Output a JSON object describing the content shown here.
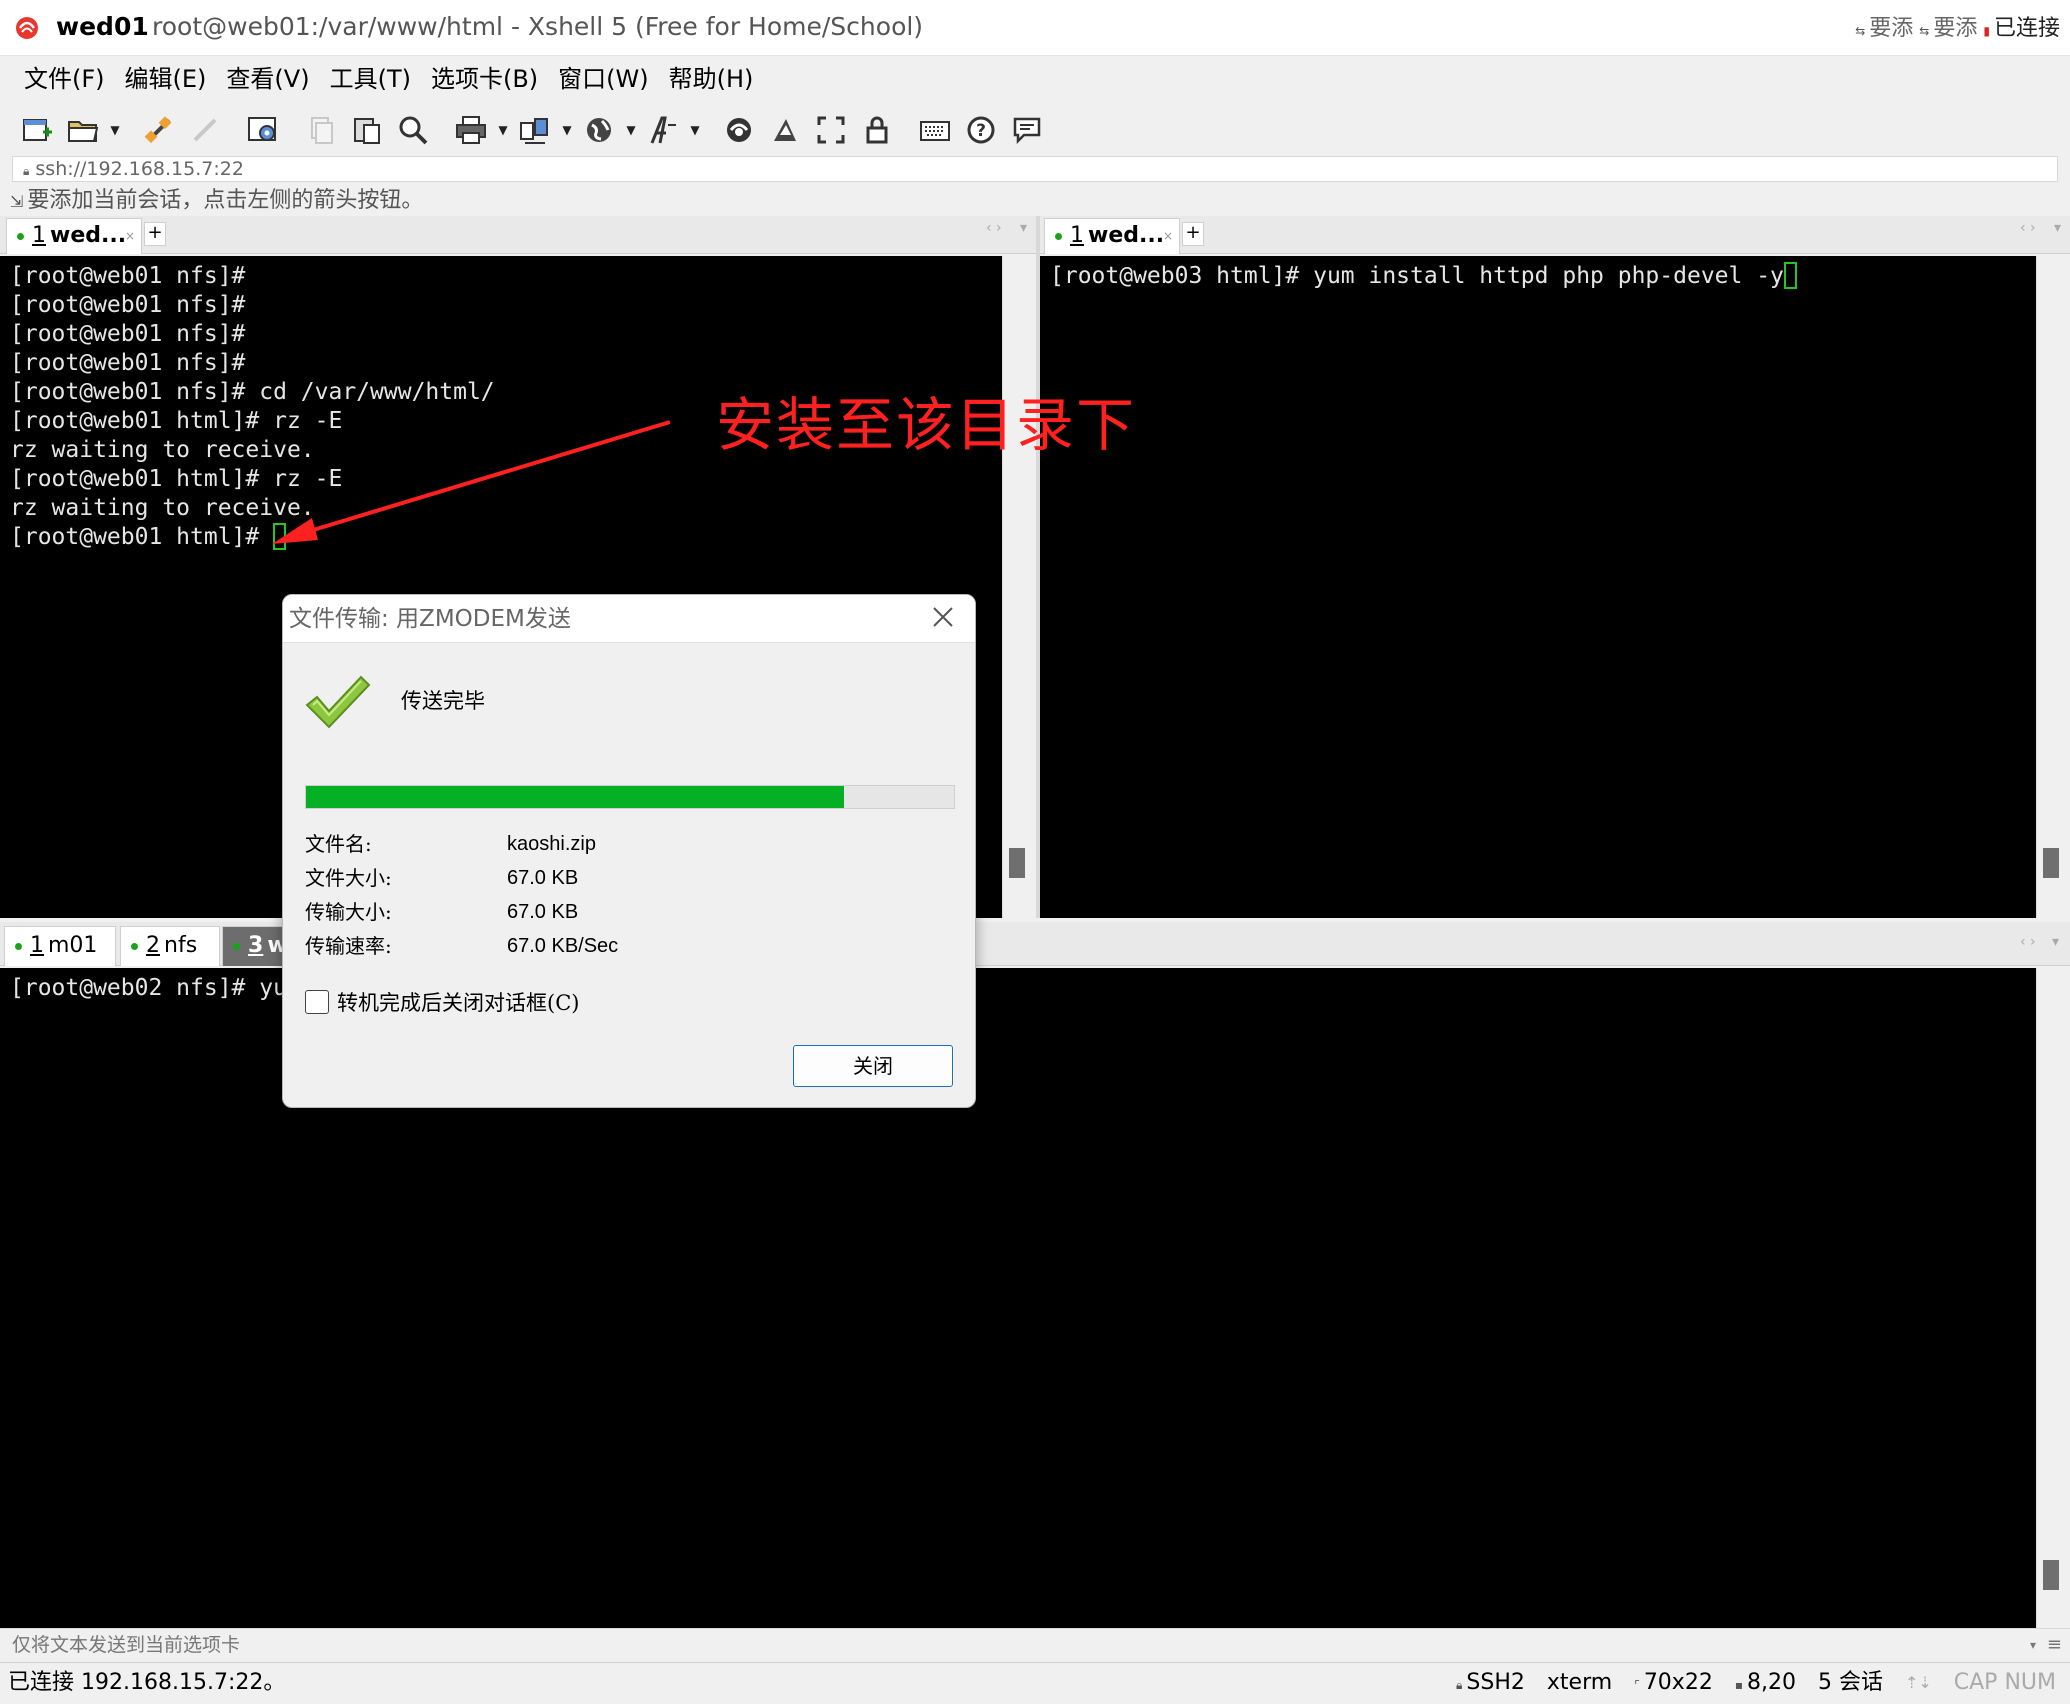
{
  "window": {
    "app_name": "wed01",
    "title_rest": "root@web01:/var/www/html - Xshell 5 (Free for Home/School)",
    "tray_texts": [
      "要添",
      "要添",
      "已连接"
    ]
  },
  "menu": [
    "文件(F)",
    "编辑(E)",
    "查看(V)",
    "工具(T)",
    "选项卡(B)",
    "窗口(W)",
    "帮助(H)"
  ],
  "address": "ssh://192.168.15.7:22",
  "hint": "要添加当前会话，点击左侧的箭头按钮。",
  "pane_top_left": {
    "tab_label": "wed...",
    "tab_num": "1",
    "lines": [
      "[root@web01 nfs]#",
      "[root@web01 nfs]#",
      "[root@web01 nfs]#",
      "[root@web01 nfs]#",
      "[root@web01 nfs]# cd /var/www/html/",
      "[root@web01 html]# rz -E",
      "rz waiting to receive.",
      "[root@web01 html]# rz -E",
      "rz waiting to receive.",
      "[root@web01 html]# "
    ]
  },
  "pane_top_right": {
    "tab_label": "wed...",
    "tab_num": "1",
    "lines": [
      "[root@web03 html]# yum install httpd php php-devel -y"
    ]
  },
  "pane_bottom": {
    "tabs": [
      {
        "num": "1",
        "label": "m01"
      },
      {
        "num": "2",
        "label": "nfs"
      },
      {
        "num": "3",
        "label": "w"
      }
    ],
    "lines": [
      "[root@web02 nfs]# yu"
    ]
  },
  "annotation": "安装至该目录下",
  "dialog": {
    "title": "文件传输: 用ZMODEM发送",
    "status": "传送完毕",
    "progress_fraction": 0.83,
    "rows": [
      {
        "label": "文件名:",
        "value": "kaoshi.zip"
      },
      {
        "label": "文件大小:",
        "value": "67.0 KB"
      },
      {
        "label": "传输大小:",
        "value": "67.0 KB"
      },
      {
        "label": "传输速率:",
        "value": "67.0 KB/Sec"
      }
    ],
    "checkbox_label": "转机完成后关闭对话框(C)",
    "close_button": "关闭"
  },
  "sendbar": "仅将文本发送到当前选项卡",
  "status": {
    "left": "已连接 192.168.15.7:22。",
    "protocol": "SSH2",
    "term": "xterm",
    "size": "70x22",
    "pos": "8,20",
    "sessions": "5 会话",
    "caps": "CAP",
    "num": "NUM"
  },
  "colors": {
    "terminal_bg": "#000000",
    "terminal_fg": "#e6e6e6",
    "cursor": "#26c426",
    "annotation": "#ff2020",
    "progress": "#06b025",
    "status_dot": "#1aa31a"
  },
  "icons": [
    "new-session-icon",
    "open-folder-icon",
    "connect-icon",
    "disconnect-icon",
    "properties-icon",
    "copy-icon",
    "paste-icon",
    "find-icon",
    "print-icon",
    "transfer-icon",
    "globe-icon",
    "font-icon",
    "xftp-icon",
    "xmanager-icon",
    "fullscreen-icon",
    "lock-icon",
    "keyboard-icon",
    "help-icon",
    "chat-icon"
  ]
}
